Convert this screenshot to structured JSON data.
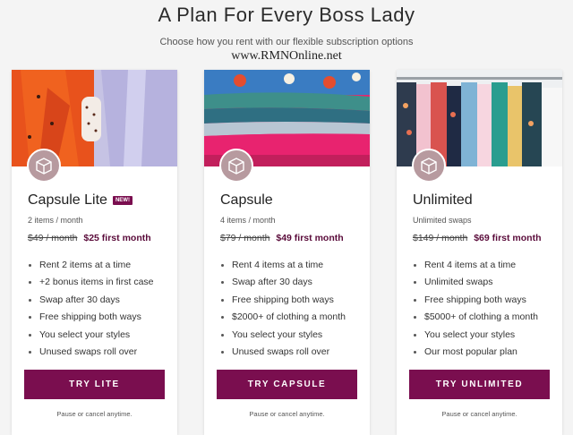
{
  "header": {
    "title": "A Plan For Every Boss Lady",
    "subtitle": "Choose how you rent with our flexible subscription options",
    "watermark": "www.RMNOnline.net"
  },
  "colors": {
    "accent": "#7a0e4f",
    "price_accent": "#5a0b3a",
    "icon_circle": "#b79a9f"
  },
  "plans": [
    {
      "name": "Capsule Lite",
      "tag": "NEW!",
      "items": "2 items / month",
      "old_price": "$49 / month",
      "first_month": "$25 first month",
      "features": [
        "Rent 2 items at a time",
        "+2 bonus items in first case",
        "Swap after 30 days",
        "Free shipping both ways",
        "You select your styles",
        "Unused swaps roll over"
      ],
      "button": "TRY LITE",
      "fineprint": "Pause or cancel anytime.",
      "icon": "box-2-icon"
    },
    {
      "name": "Capsule",
      "items": "4 items / month",
      "old_price": "$79 / month",
      "first_month": "$49 first month",
      "features": [
        "Rent 4 items at a time",
        "Swap after 30 days",
        "Free shipping both ways",
        "$2000+ of clothing a month",
        "You select your styles",
        "Unused swaps roll over"
      ],
      "button": "TRY CAPSULE",
      "fineprint": "Pause or cancel anytime.",
      "icon": "box-4-icon"
    },
    {
      "name": "Unlimited",
      "items": "Unlimited swaps",
      "old_price": "$149 / month",
      "first_month": "$69 first month",
      "features": [
        "Rent 4 items at a time",
        "Unlimited swaps",
        "Free shipping both ways",
        "$5000+ of clothing a month",
        "You select your styles",
        "Our most popular plan"
      ],
      "button": "TRY UNLIMITED",
      "fineprint": "Pause or cancel anytime.",
      "icon": "box-refresh-icon"
    }
  ]
}
